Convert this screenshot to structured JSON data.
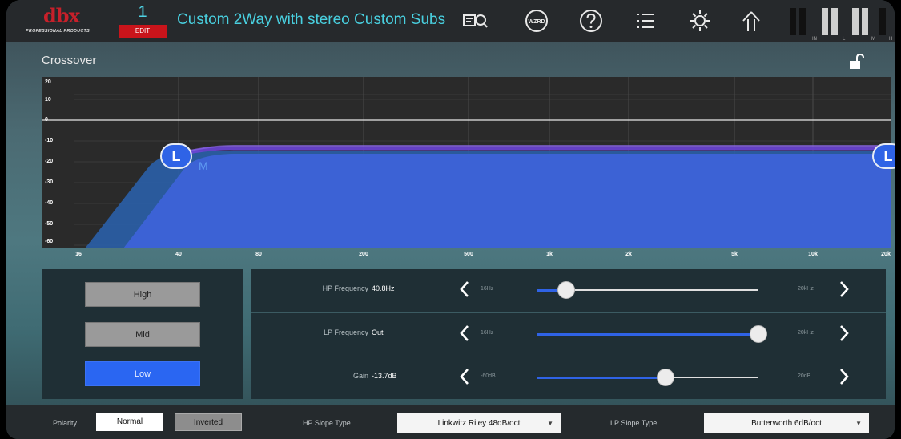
{
  "header": {
    "brand": "dbx",
    "brand_sub": "PROFESSIONAL PRODUCTS",
    "preset_number": "1",
    "edit_label": "EDIT",
    "preset_name": "Custom 2Way with stereo Custom Subs",
    "icons": [
      "eq-view-icon",
      "wizard-icon",
      "help-icon",
      "menu-icon",
      "settings-icon",
      "home-icon"
    ],
    "wizard_text": "WZRD",
    "meter_labels": [
      "IN",
      "L",
      "M",
      "H"
    ]
  },
  "crossover": {
    "title": "Crossover",
    "y_ticks": [
      "20",
      "10",
      "0",
      "-10",
      "-20",
      "-30",
      "-40",
      "-50",
      "-60"
    ],
    "x_ticks": [
      "16",
      "40",
      "80",
      "200",
      "500",
      "1k",
      "2k",
      "5k",
      "10k",
      "20k"
    ],
    "hp_handle": "L",
    "lp_handle": "L",
    "fill_color": "#3d63d8",
    "band_marker": "M"
  },
  "bands": {
    "high": "High",
    "mid": "Mid",
    "low": "Low",
    "selected": "Low"
  },
  "params": {
    "hp": {
      "label": "HP Frequency",
      "value": "40.8Hz",
      "min": "16Hz",
      "max": "20kHz",
      "position": 0.13
    },
    "lp": {
      "label": "LP Frequency",
      "value": "Out",
      "min": "16Hz",
      "max": "20kHz",
      "position": 1.0
    },
    "gain": {
      "label": "Gain",
      "value": "-13.7dB",
      "min": "-60dB",
      "max": "20dB",
      "position": 0.58
    }
  },
  "footer": {
    "polarity_label": "Polarity",
    "normal_label": "Normal",
    "inverted_label": "Inverted",
    "hp_slope_label": "HP Slope Type",
    "hp_slope_value": "Linkwitz Riley 48dB/oct",
    "lp_slope_label": "LP Slope Type",
    "lp_slope_value": "Butterworth 6dB/oct",
    "caret": "▼"
  }
}
